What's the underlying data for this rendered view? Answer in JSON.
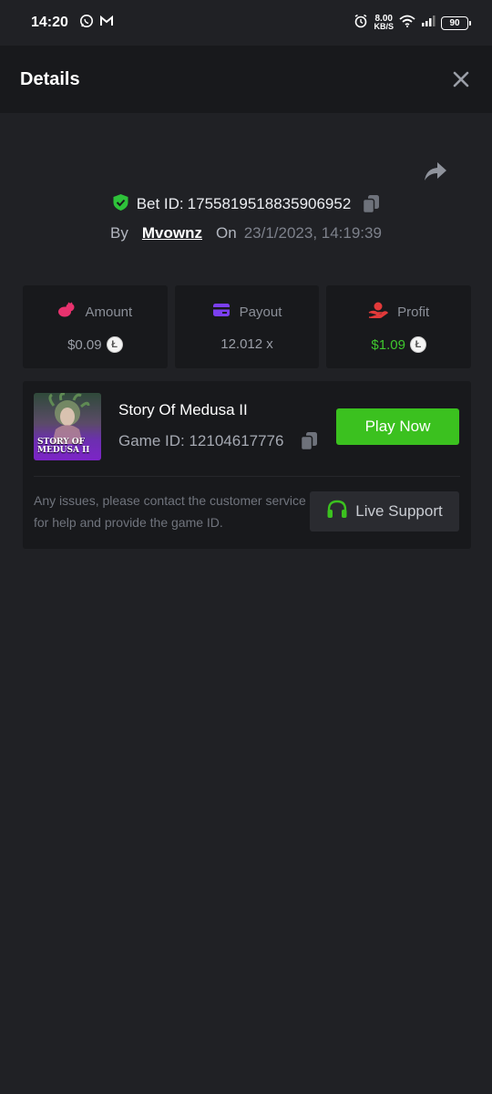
{
  "status_bar": {
    "time": "14:20",
    "net_speed_value": "8.00",
    "net_speed_unit": "KB/S",
    "battery": "90"
  },
  "header": {
    "title": "Details"
  },
  "bet": {
    "label": "Bet ID:",
    "id": "1755819518835906952",
    "by_label": "By",
    "user": "Mvownz",
    "on_label": "On",
    "datetime": "23/1/2023, 14:19:39"
  },
  "stats": [
    {
      "label": "Amount",
      "value": "$0.09",
      "icon": "coins-icon",
      "color": "#e8326e"
    },
    {
      "label": "Payout",
      "value": "12.012 x",
      "icon": "card-icon",
      "color": "#7b3ff0"
    },
    {
      "label": "Profit",
      "value": "$1.09",
      "icon": "hand-coin-icon",
      "color": "#e23a3a"
    }
  ],
  "game": {
    "thumbnail_text": "STORY OF MEDUSA II",
    "name": "Story Of Medusa II",
    "id_label": "Game ID: 12104617776",
    "play_button": "Play Now"
  },
  "support": {
    "help_text": "Any issues, please contact the customer service for help and provide the game ID.",
    "button_label": "Live Support"
  },
  "colors": {
    "background": "#202125",
    "panel": "#18191c",
    "accent_green": "#3bc11f",
    "profit_green": "#3fc72e"
  }
}
